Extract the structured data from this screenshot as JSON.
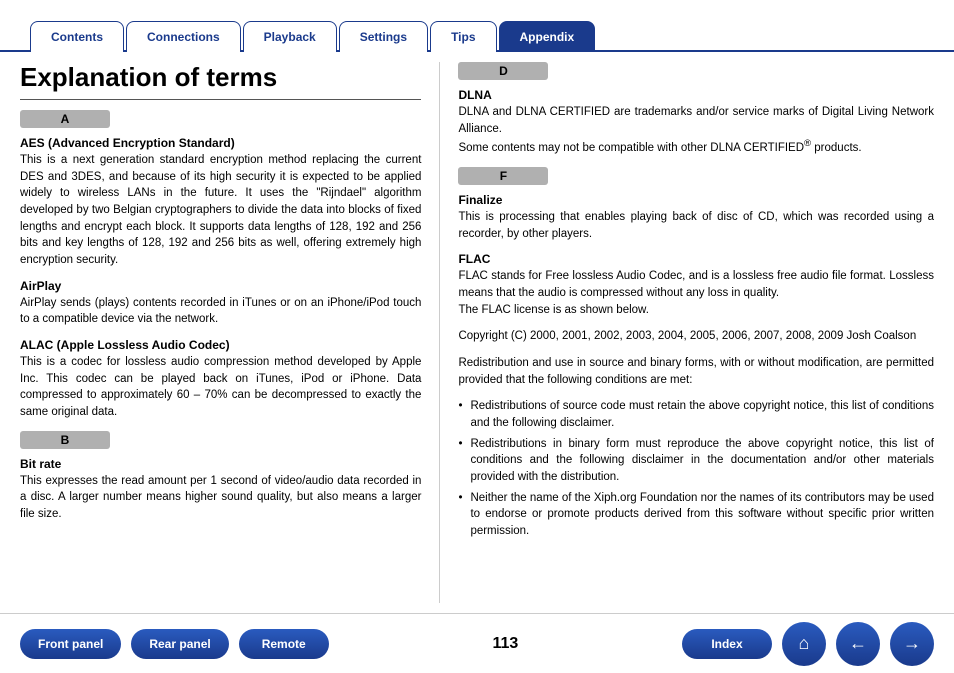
{
  "tabs": [
    {
      "label": "Contents",
      "active": false
    },
    {
      "label": "Connections",
      "active": false
    },
    {
      "label": "Playback",
      "active": false
    },
    {
      "label": "Settings",
      "active": false
    },
    {
      "label": "Tips",
      "active": false
    },
    {
      "label": "Appendix",
      "active": true
    }
  ],
  "page_title": "Explanation of terms",
  "left": {
    "section_a": {
      "letter": "A",
      "terms": [
        {
          "title": "AES (Advanced Encryption Standard)",
          "body": "This is a next generation standard encryption method replacing the current DES and 3DES, and because of its high security it is expected to be applied widely to wireless LANs in the future. It uses the \"Rijndael\" algorithm developed by two Belgian cryptographers to divide the data into blocks of fixed lengths and encrypt each block. It supports data lengths of 128, 192 and 256 bits and key lengths of 128, 192 and 256 bits as well, offering extremely high encryption security."
        },
        {
          "title": "AirPlay",
          "body": "AirPlay sends (plays) contents recorded in iTunes or on an iPhone/iPod touch to a compatible device via the network."
        },
        {
          "title": "ALAC (Apple Lossless Audio Codec)",
          "body": "This is a codec for lossless audio compression method developed by Apple Inc. This codec can be played back on iTunes, iPod or iPhone. Data compressed to approximately 60 – 70% can be decompressed to exactly the same original data."
        }
      ]
    },
    "section_b": {
      "letter": "B",
      "terms": [
        {
          "title": "Bit rate",
          "body": "This expresses the read amount per 1 second of video/audio data recorded in a disc. A larger number means higher sound quality, but also means a larger file size."
        }
      ]
    }
  },
  "right": {
    "section_d": {
      "letter": "D",
      "terms": [
        {
          "title": "DLNA",
          "body": "DLNA and DLNA CERTIFIED are trademarks and/or service marks of Digital Living Network Alliance.\nSome contents may not be compatible with other DLNA CERTIFIED® products."
        }
      ]
    },
    "section_f": {
      "letter": "F",
      "terms": [
        {
          "title": "Finalize",
          "body": "This is processing that enables playing back of disc of CD, which was recorded using a recorder, by other players."
        },
        {
          "title": "FLAC",
          "body": "FLAC stands for Free lossless Audio Codec, and is a lossless free audio file format. Lossless means that the audio is compressed without any loss in quality.\nThe FLAC license is as shown below."
        }
      ]
    },
    "flac_copyright": "Copyright (C) 2000, 2001, 2002, 2003, 2004, 2005, 2006, 2007, 2008, 2009 Josh Coalson",
    "flac_redistribution": "Redistribution and use in source and binary forms, with or without modification, are permitted provided that the following conditions are met:",
    "flac_bullets": [
      "Redistributions of source code must retain the above copyright notice, this list of conditions and the following disclaimer.",
      "Redistributions in binary form must reproduce the above copyright notice, this list of conditions and the following disclaimer in the documentation and/or other materials provided with the distribution.",
      "Neither the name of the Xiph.org Foundation nor the names of its contributors may be used to endorse or promote products derived from this software without specific prior written permission."
    ]
  },
  "footer": {
    "buttons": [
      {
        "label": "Front panel",
        "name": "front-panel-button"
      },
      {
        "label": "Rear panel",
        "name": "rear-panel-button"
      },
      {
        "label": "Remote",
        "name": "remote-button"
      },
      {
        "label": "Index",
        "name": "index-button"
      }
    ],
    "page_number": "113",
    "icons": [
      {
        "name": "home-icon",
        "symbol": "⌂"
      },
      {
        "name": "back-icon",
        "symbol": "←"
      },
      {
        "name": "forward-icon",
        "symbol": "→"
      }
    ]
  }
}
